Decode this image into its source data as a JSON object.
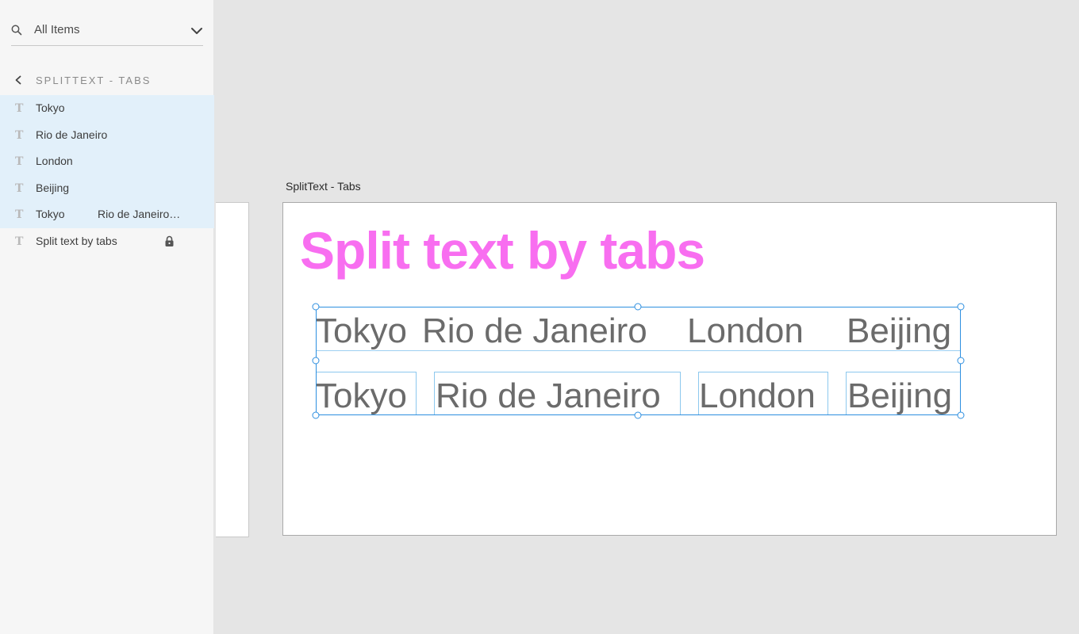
{
  "sidebar": {
    "search": {
      "label": "All Items"
    },
    "breadcrumb": {
      "label": "SPLITTEXT - TABS"
    },
    "layers": [
      {
        "name": "Tokyo",
        "selected": true
      },
      {
        "name": "Rio de Janeiro",
        "selected": true
      },
      {
        "name": "London",
        "selected": true
      },
      {
        "name": "Beijing",
        "selected": true
      },
      {
        "name": "Tokyo",
        "name2": "Rio de Janeiro…",
        "selected": true
      },
      {
        "name": "Split text by tabs",
        "selected": false,
        "locked": true
      }
    ]
  },
  "canvas": {
    "artboard_title": "SplitText - Tabs",
    "heading": "Split text by tabs",
    "heading_color": "#f86ef0",
    "selection_color": "#2d8fe0",
    "row1": [
      "Tokyo",
      "Rio de Janeiro",
      "London",
      "Beijing"
    ],
    "row2": [
      "Tokyo",
      "Rio de Janeiro",
      "London",
      "Beijing"
    ]
  }
}
